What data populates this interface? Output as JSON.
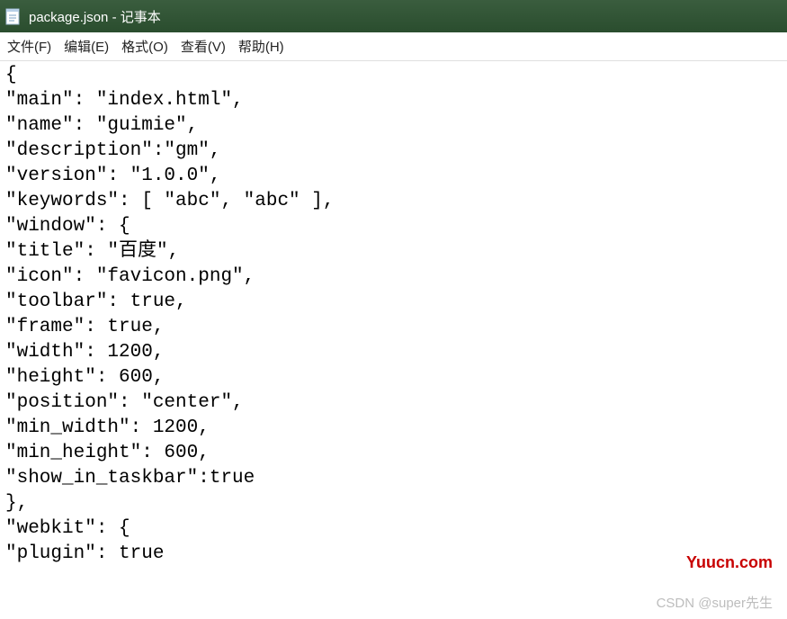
{
  "titlebar": {
    "title": "package.json - 记事本"
  },
  "menubar": {
    "file": "文件(F)",
    "edit": "编辑(E)",
    "format": "格式(O)",
    "view": "查看(V)",
    "help": "帮助(H)"
  },
  "content": "{\n\"main\": \"index.html\",\n\"name\": \"guimie\",\n\"description\":\"gm\",\n\"version\": \"1.0.0\",\n\"keywords\": [ \"abc\", \"abc\" ],\n\"window\": {\n\"title\": \"百度\",\n\"icon\": \"favicon.png\",\n\"toolbar\": true,\n\"frame\": true,\n\"width\": 1200,\n\"height\": 600,\n\"position\": \"center\",\n\"min_width\": 1200,\n\"min_height\": 600,\n\"show_in_taskbar\":true\n},\n\"webkit\": {\n\"plugin\": true",
  "watermarks": {
    "yuucn": "Yuucn.com",
    "csdn": "CSDN @super先生"
  }
}
